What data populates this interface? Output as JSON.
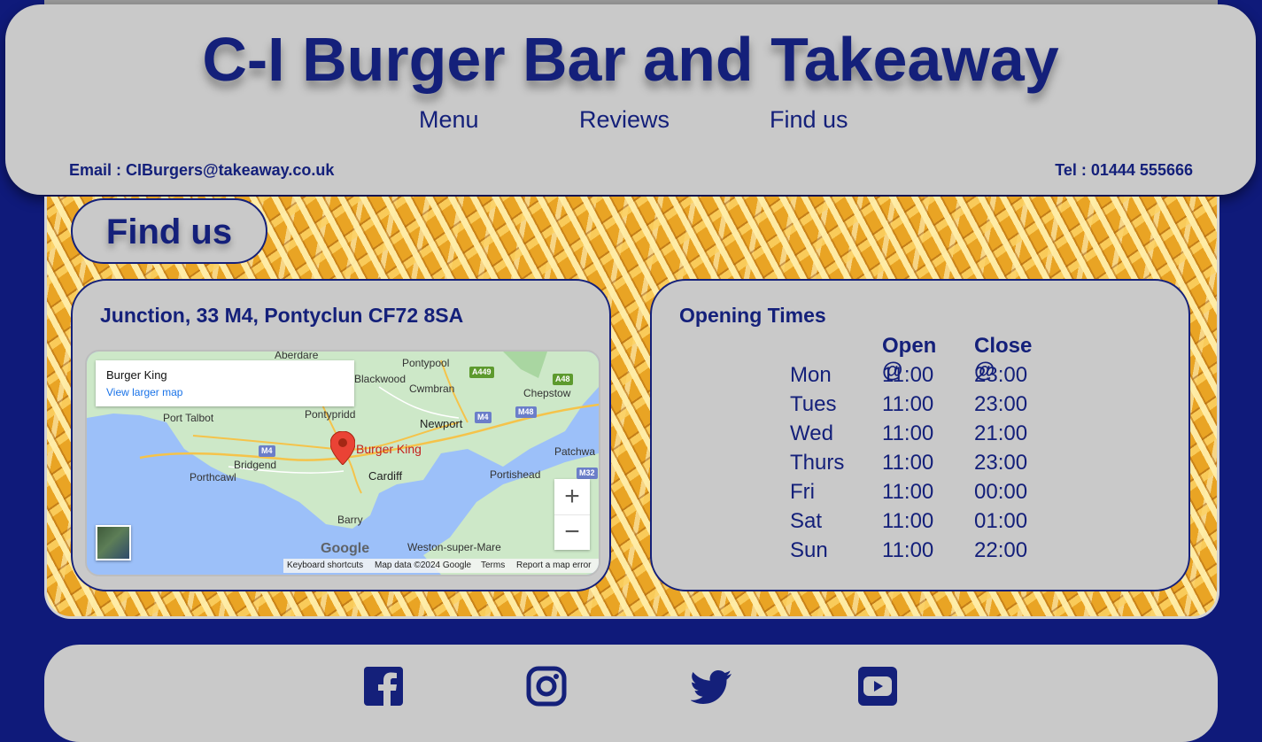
{
  "header": {
    "title": "C-I Burger Bar and Takeaway",
    "nav": [
      "Menu",
      "Reviews",
      "Find us"
    ],
    "email": "Email : CIBurgers@takeaway.co.uk",
    "tel": "Tel : 01444 555666"
  },
  "section": {
    "title": "Find us"
  },
  "address": {
    "heading": "Junction, 33 M4, Pontyclun CF72 8SA"
  },
  "map": {
    "place_name": "Burger King",
    "larger_link": "View larger map",
    "marker_label": "Burger King",
    "places": [
      "Aberdare",
      "Pontypool",
      "Blackwood",
      "Cwmbran",
      "Chepstow",
      "Port Talbot",
      "Pontypridd",
      "Newport",
      "Bridgend",
      "Porthcawl",
      "Cardiff",
      "Portishead",
      "Patchwa",
      "Barry",
      "Weston-super-Mare"
    ],
    "roads": [
      "A449",
      "A48",
      "M4",
      "M48",
      "M4",
      "M32"
    ],
    "google_logo": "Google",
    "attribution": [
      "Keyboard shortcuts",
      "Map data ©2024 Google",
      "Terms",
      "Report a map error"
    ],
    "zoom_in": "+",
    "zoom_out": "−",
    "colors": {
      "water": "#9cc0f9",
      "land": "#cde8c8",
      "marker": "#ea4335"
    }
  },
  "hours": {
    "heading": "Opening Times",
    "columns": [
      "Open @",
      "Close @"
    ],
    "rows": [
      {
        "day": "Mon",
        "open": "11:00",
        "close": "23:00"
      },
      {
        "day": "Tues",
        "open": "11:00",
        "close": "23:00"
      },
      {
        "day": "Wed",
        "open": "11:00",
        "close": "21:00"
      },
      {
        "day": "Thurs",
        "open": "11:00",
        "close": "23:00"
      },
      {
        "day": "Fri",
        "open": "11:00",
        "close": "00:00"
      },
      {
        "day": "Sat",
        "open": "11:00",
        "close": "01:00"
      },
      {
        "day": "Sun",
        "open": "11:00",
        "close": "22:00"
      }
    ]
  },
  "footer": {
    "social_icons": [
      "facebook-icon",
      "instagram-icon",
      "twitter-icon",
      "youtube-icon"
    ]
  },
  "colors": {
    "brand": "#14207a",
    "panel": "#c9c9c9",
    "background": "#0f1a7a"
  }
}
